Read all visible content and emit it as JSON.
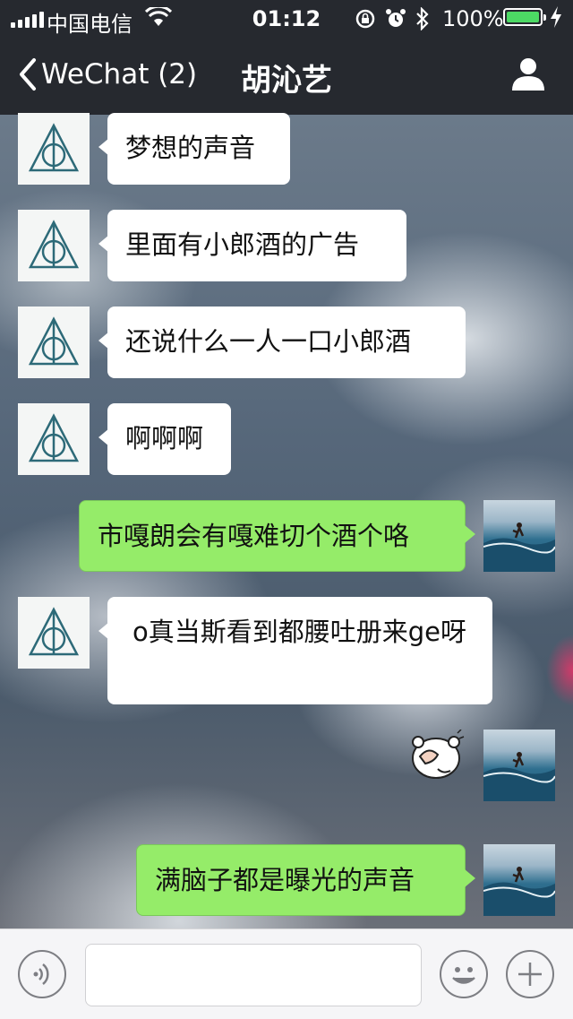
{
  "status_bar": {
    "carrier": "中国电信",
    "time": "01:12",
    "battery": "100%"
  },
  "nav": {
    "back_label": "WeChat (2)",
    "title": "胡沁艺"
  },
  "messages": [
    {
      "side": "in",
      "text": "梦想的声音"
    },
    {
      "side": "in",
      "text": "里面有小郎酒的广告"
    },
    {
      "side": "in",
      "text": "还说什么一人一口小郎酒"
    },
    {
      "side": "in",
      "text": "啊啊啊"
    },
    {
      "side": "out",
      "text": "市嘎朗会有嘎难切个酒个咯"
    },
    {
      "side": "in",
      "text": "o真当斯看到都腰吐册来ge呀"
    },
    {
      "side": "out",
      "type": "sticker",
      "sticker": "covering-face-bear"
    },
    {
      "side": "out",
      "text": "满脑子都是曝光的声音"
    }
  ],
  "icons": {
    "back": "chevron-left-icon",
    "profile": "person-icon",
    "voice": "voice-icon",
    "emoji": "smiley-icon",
    "more": "plus-icon"
  },
  "colors": {
    "bar_bg": "#26292f",
    "bubble_out": "#95ec69",
    "bubble_in": "#ffffff",
    "battery": "#4cd964"
  }
}
